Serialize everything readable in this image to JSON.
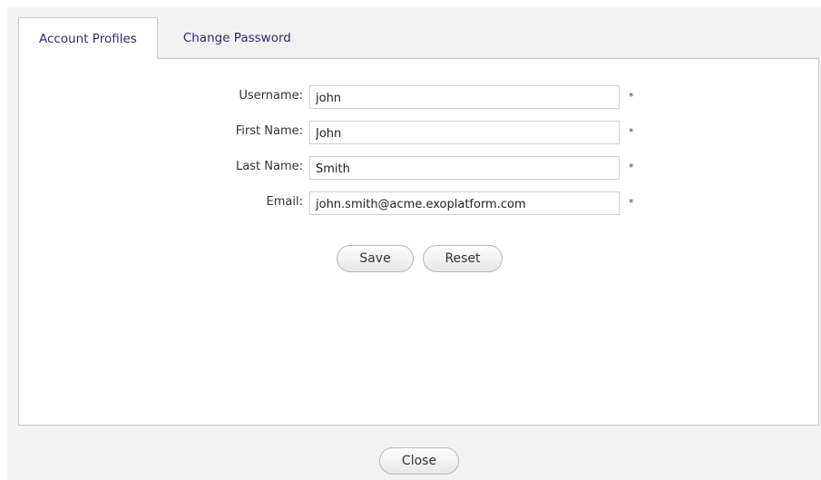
{
  "tabs": [
    {
      "label": "Account Profiles",
      "active": true
    },
    {
      "label": "Change Password",
      "active": false
    }
  ],
  "form": {
    "fields": [
      {
        "label": "Username:",
        "value": "john",
        "required_mark": "*"
      },
      {
        "label": "First Name:",
        "value": "John",
        "required_mark": "*"
      },
      {
        "label": "Last Name:",
        "value": "Smith",
        "required_mark": "*"
      },
      {
        "label": "Email:",
        "value": "john.smith@acme.exoplatform.com",
        "required_mark": "*"
      }
    ],
    "save_label": "Save",
    "reset_label": "Reset"
  },
  "footer": {
    "close_label": "Close"
  }
}
